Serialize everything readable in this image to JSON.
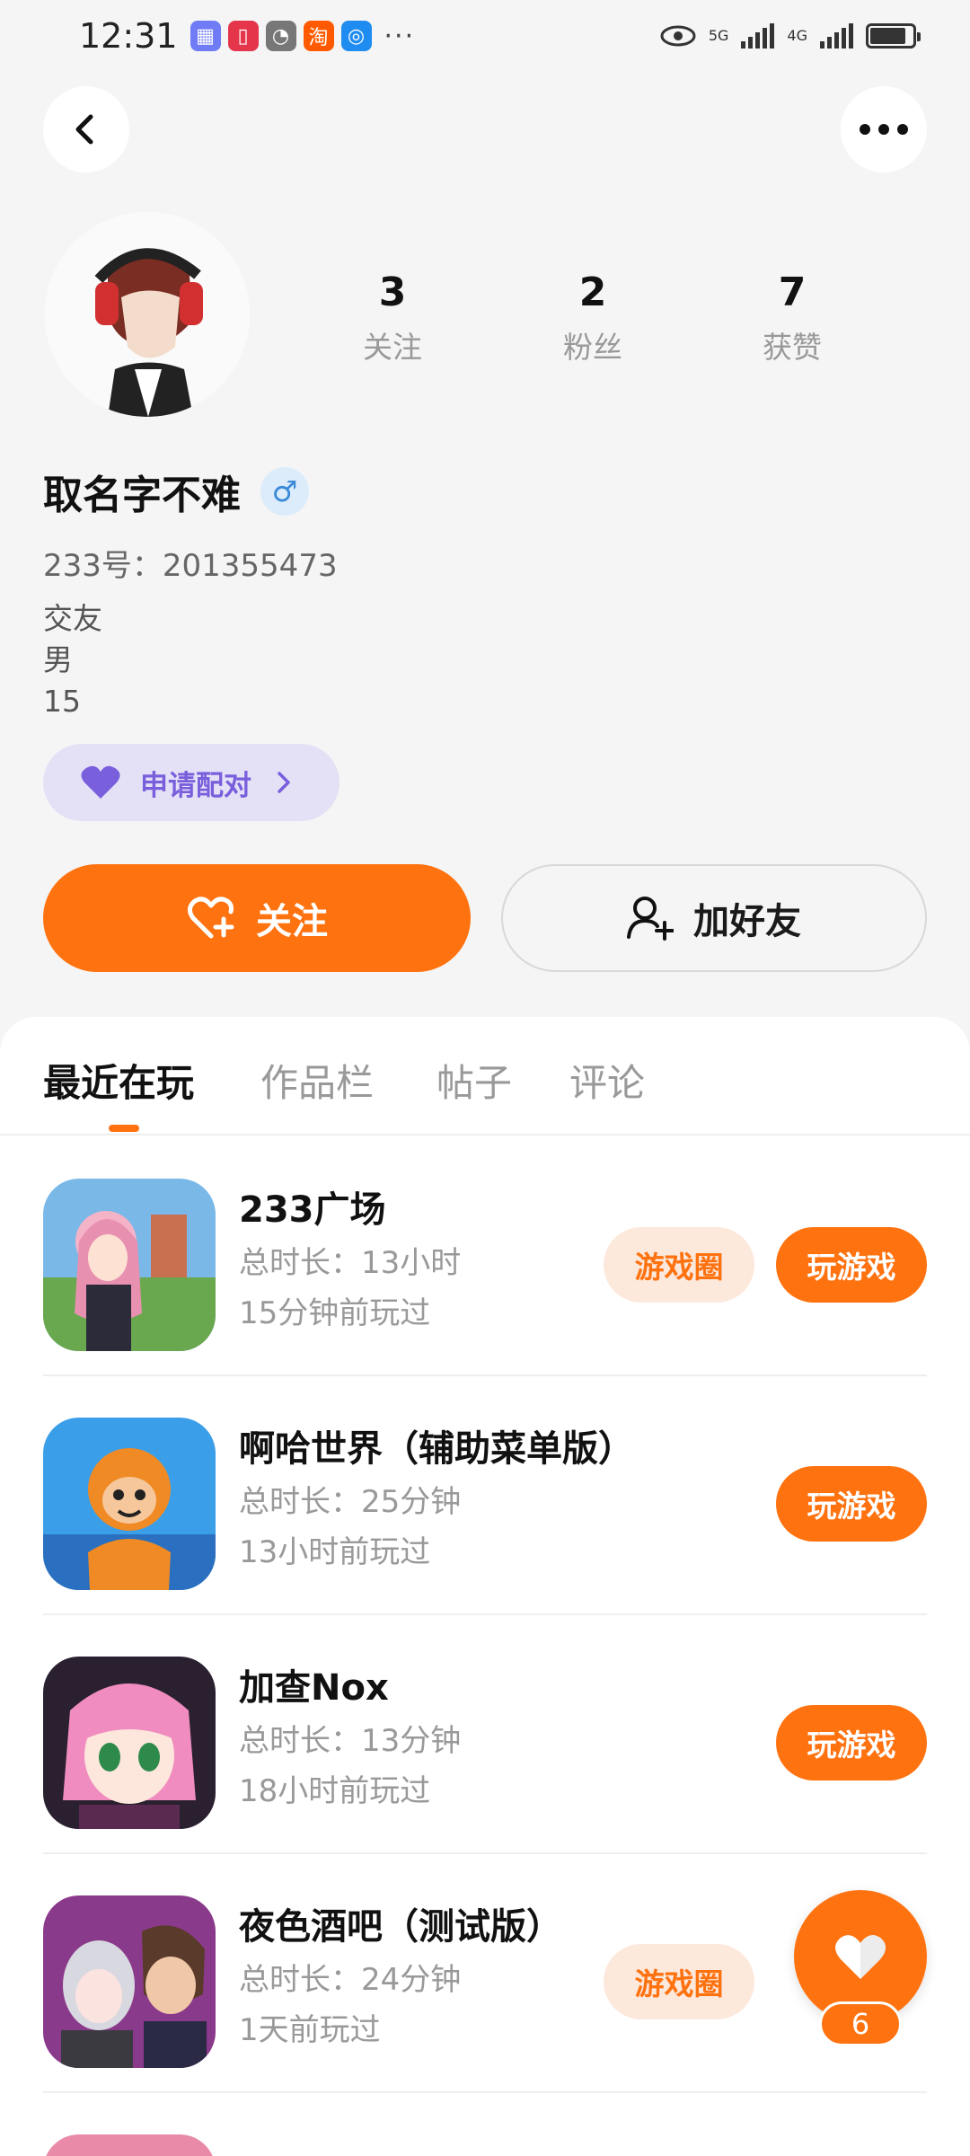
{
  "status_bar": {
    "time": "12:31",
    "more": "···",
    "net1": "5G",
    "net2": "4G",
    "apps": [
      {
        "icon": "app-tile-icon",
        "color": "#6f7cf5"
      },
      {
        "icon": "book-app-icon",
        "color": "#e5354b"
      },
      {
        "icon": "wechat-icon",
        "color": "#555555"
      },
      {
        "icon": "taobao-icon",
        "color": "#ff5a00"
      },
      {
        "icon": "search-app-icon",
        "color": "#1e8cf0"
      }
    ],
    "battery_level": 0.85
  },
  "header": {
    "back_icon": "chevron-left-icon",
    "more_icon": "more-dots-icon"
  },
  "profile": {
    "stats": [
      {
        "value": "3",
        "label": "关注"
      },
      {
        "value": "2",
        "label": "粉丝"
      },
      {
        "value": "7",
        "label": "获赞"
      }
    ],
    "nickname": "取名字不难",
    "gender_symbol": "♂",
    "uid": "233号：201355473",
    "bio_lines": [
      "交友",
      "男",
      "15"
    ],
    "pair_button": "申请配对",
    "follow_button": "关注",
    "add_friend_button": "加好友"
  },
  "tabs": [
    {
      "label": "最近在玩",
      "active": true
    },
    {
      "label": "作品栏",
      "active": false
    },
    {
      "label": "帖子",
      "active": false
    },
    {
      "label": "评论",
      "active": false
    }
  ],
  "games": [
    {
      "name": "233广场",
      "line1": "总时长：13小时",
      "line2": "15分钟前玩过",
      "circle": "游戏圈",
      "play": "玩游戏"
    },
    {
      "name": "啊哈世界（辅助菜单版）",
      "line1": "总时长：25分钟",
      "line2": "13小时前玩过",
      "circle": "",
      "play": "玩游戏"
    },
    {
      "name": "加查Nox",
      "line1": "总时长：13分钟",
      "line2": "18小时前玩过",
      "circle": "",
      "play": "玩游戏"
    },
    {
      "name": "夜色酒吧（测试版）",
      "line1": "总时长：24分钟",
      "line2": "1天前玩过",
      "circle": "游戏圈",
      "play": ""
    }
  ],
  "floating_like": {
    "count": "6"
  },
  "colors": {
    "accent": "#ff7210",
    "pair": "#7a5fdc",
    "tab_inactive": "#999999"
  }
}
